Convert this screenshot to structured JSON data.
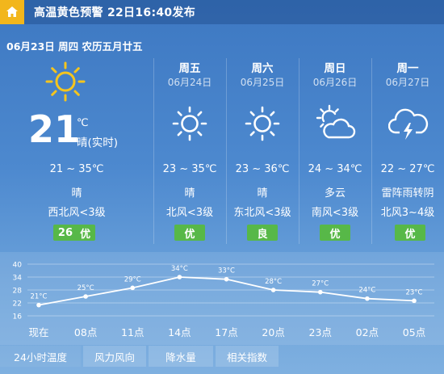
{
  "alert": {
    "text": "高温黄色预警 22日16:40发布"
  },
  "today": {
    "date_line": "06月23日 周四 农历五月廿五",
    "temp": "21",
    "unit": "℃",
    "desc": "晴(实时)",
    "range": "21 ~ 35℃",
    "weather": "晴",
    "wind": "西北风<3级",
    "aqi_value": "26",
    "aqi_label": "优",
    "icon": "sun-icon"
  },
  "forecast": [
    {
      "day": "周五",
      "date": "06月24日",
      "range": "23 ~ 35℃",
      "weather": "晴",
      "wind": "北风<3级",
      "aqi": "优",
      "icon": "sun-icon"
    },
    {
      "day": "周六",
      "date": "06月25日",
      "range": "23 ~ 36℃",
      "weather": "晴",
      "wind": "东北风<3级",
      "aqi": "良",
      "icon": "sun-icon"
    },
    {
      "day": "周日",
      "date": "06月26日",
      "range": "24 ~ 34℃",
      "weather": "多云",
      "wind": "南风<3级",
      "aqi": "优",
      "icon": "partly-cloudy-icon"
    },
    {
      "day": "周一",
      "date": "06月27日",
      "range": "22 ~ 27℃",
      "weather": "雷阵雨转阴",
      "wind": "北风3~4级",
      "aqi": "优",
      "icon": "thunderstorm-icon"
    }
  ],
  "colors": {
    "aqi_good": "#57b848",
    "aqi_moderate": "#d8c51c",
    "sun": "#f5c51d",
    "alert_home": "#f2b61c"
  },
  "chart_data": {
    "type": "line",
    "x": [
      "现在",
      "08点",
      "11点",
      "14点",
      "17点",
      "20点",
      "23点",
      "02点",
      "05点"
    ],
    "y": [
      21,
      25,
      29,
      34,
      33,
      28,
      27,
      24,
      23
    ],
    "point_labels": [
      "21°C",
      "25°C",
      "29°C",
      "34°C",
      "33°C",
      "28°C",
      "27°C",
      "24°C",
      "23°C"
    ],
    "yticks": [
      "40",
      "34",
      "28",
      "22",
      "16"
    ],
    "ylim": [
      16,
      40
    ],
    "grid": true
  },
  "tabs": [
    "24小时温度",
    "风力风向",
    "降水量",
    "相关指数"
  ]
}
